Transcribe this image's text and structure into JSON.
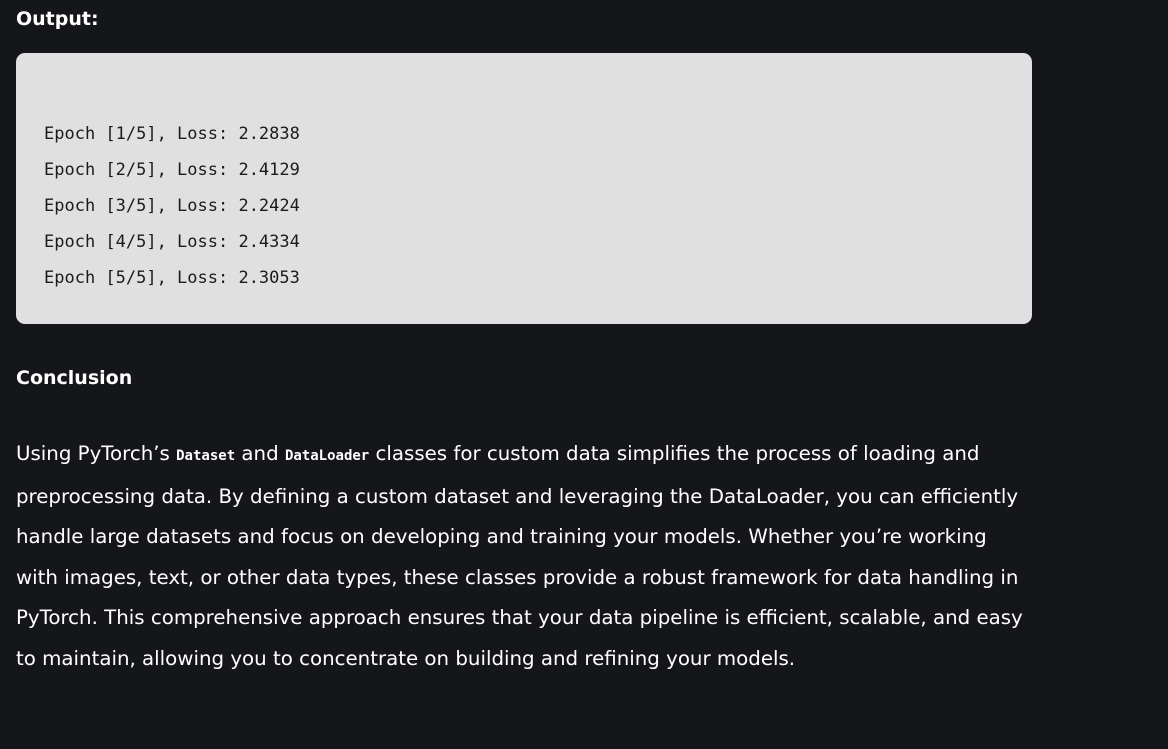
{
  "output_label": "Output:",
  "code_output": {
    "lines": [
      "Epoch [1/5], Loss: 2.2838",
      "Epoch [2/5], Loss: 2.4129",
      "Epoch [3/5], Loss: 2.2424",
      "Epoch [4/5], Loss: 2.4334",
      "Epoch [5/5], Loss: 2.3053"
    ]
  },
  "conclusion": {
    "heading": "Conclusion",
    "text_1": "Using PyTorch’s ",
    "code_1": "Dataset",
    "text_2": " and ",
    "code_2": "DataLoader",
    "text_3": " classes for custom data simplifies the process of loading and preprocessing data. By defining a custom dataset and leveraging the DataLoader, you can efficiently handle large datasets and focus on developing and training your models. Whether you’re working with images, text, or other data types, these classes provide a robust framework for data handling in PyTorch. This comprehensive approach ensures that your data pipeline is efficient, scalable, and easy to maintain, allowing you to concentrate on building and refining your models."
  },
  "colors": {
    "page_background": "#151619",
    "code_background": "#e0e0e0",
    "code_text": "#1b1b1b",
    "body_text": "#ffffff"
  }
}
